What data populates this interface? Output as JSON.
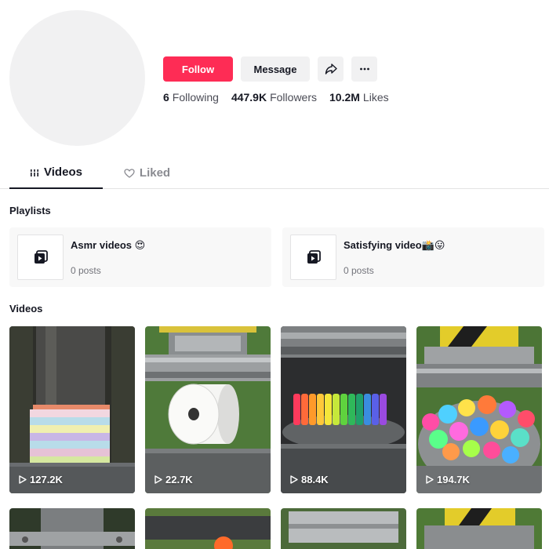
{
  "profile": {
    "follow_label": "Follow",
    "message_label": "Message",
    "stats": [
      {
        "value": "6",
        "label": "Following"
      },
      {
        "value": "447.9K",
        "label": "Followers"
      },
      {
        "value": "10.2M",
        "label": "Likes"
      }
    ]
  },
  "tabs": {
    "videos": "Videos",
    "liked": "Liked"
  },
  "sections": {
    "playlists": "Playlists",
    "videos": "Videos"
  },
  "playlists": [
    {
      "name": "Asmr videos 😍",
      "posts": "0 posts"
    },
    {
      "name": "Satisfying video📸😛",
      "posts": "0 posts"
    }
  ],
  "videos": [
    {
      "views": "127.2K",
      "scene": "sponge"
    },
    {
      "views": "22.7K",
      "scene": "paper-roll"
    },
    {
      "views": "88.4K",
      "scene": "crayons"
    },
    {
      "views": "194.7K",
      "scene": "bouncy-balls"
    }
  ],
  "icons": {
    "share": "share-icon",
    "more": "more-icon",
    "play": "play-icon",
    "playlist": "playlist-icon"
  },
  "colors": {
    "accent": "#fe2c55",
    "muted_bg": "#f1f1f2"
  }
}
